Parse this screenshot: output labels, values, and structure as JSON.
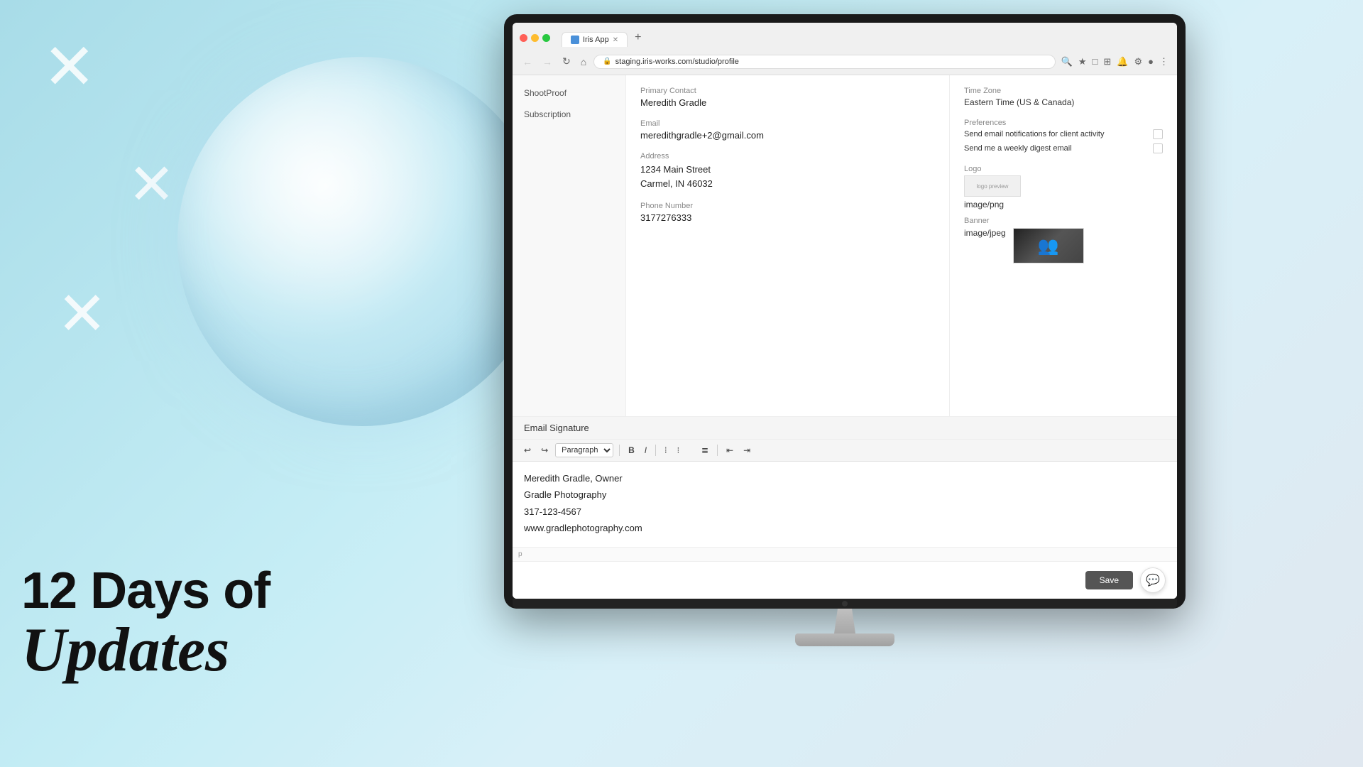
{
  "background": {
    "colors": {
      "main": "#b8e8f0",
      "gradient_start": "#a8dce8",
      "gradient_end": "#d8f0f8"
    }
  },
  "promo": {
    "line1": "12 Days of",
    "line2": "Updates"
  },
  "browser": {
    "tab_title": "Iris App",
    "tab_favicon": "iris-favicon",
    "address": "staging.iris-works.com/studio/profile",
    "new_tab_label": "+",
    "back_btn": "←",
    "forward_btn": "→",
    "refresh_btn": "↻",
    "home_btn": "⌂"
  },
  "sidebar": {
    "items": [
      {
        "label": "ShootProof",
        "id": "shootproof"
      },
      {
        "label": "Subscription",
        "id": "subscription"
      }
    ]
  },
  "profile": {
    "primary_contact": {
      "label": "Primary Contact",
      "value": "Meredith Gradle"
    },
    "email": {
      "label": "Email",
      "value": "meredithgradle+2@gmail.com"
    },
    "address": {
      "label": "Address",
      "line1": "1234 Main Street",
      "line2": "Carmel, IN 46032"
    },
    "phone": {
      "label": "Phone Number",
      "value": "3177276333"
    }
  },
  "settings": {
    "timezone": {
      "label": "Time Zone",
      "value": "Eastern Time (US & Canada)"
    },
    "preferences": {
      "label": "Preferences",
      "email_notifications": {
        "label": "Send email notifications for client activity",
        "checked": false
      },
      "weekly_digest": {
        "label": "Send me a weekly digest email",
        "checked": false
      }
    },
    "logo": {
      "label": "Logo",
      "format": "image/png"
    },
    "banner": {
      "label": "Banner",
      "format": "image/jpeg"
    }
  },
  "email_signature": {
    "title": "Email Signature",
    "toolbar": {
      "paragraph_select": "Paragraph",
      "bold": "B",
      "italic": "I",
      "align_left": "≡",
      "align_center": "≡",
      "align_right": "≡",
      "justify": "≡",
      "indent_out": "⇤",
      "indent_in": "⇥",
      "undo": "↩",
      "redo": "↪"
    },
    "content": {
      "line1": "Meredith Gradle, Owner",
      "line2": "Gradle Photography",
      "line3": "317-123-4567",
      "line4": "www.gradlephotography.com",
      "line5": "p"
    }
  },
  "footer": {
    "save_label": "Save"
  }
}
